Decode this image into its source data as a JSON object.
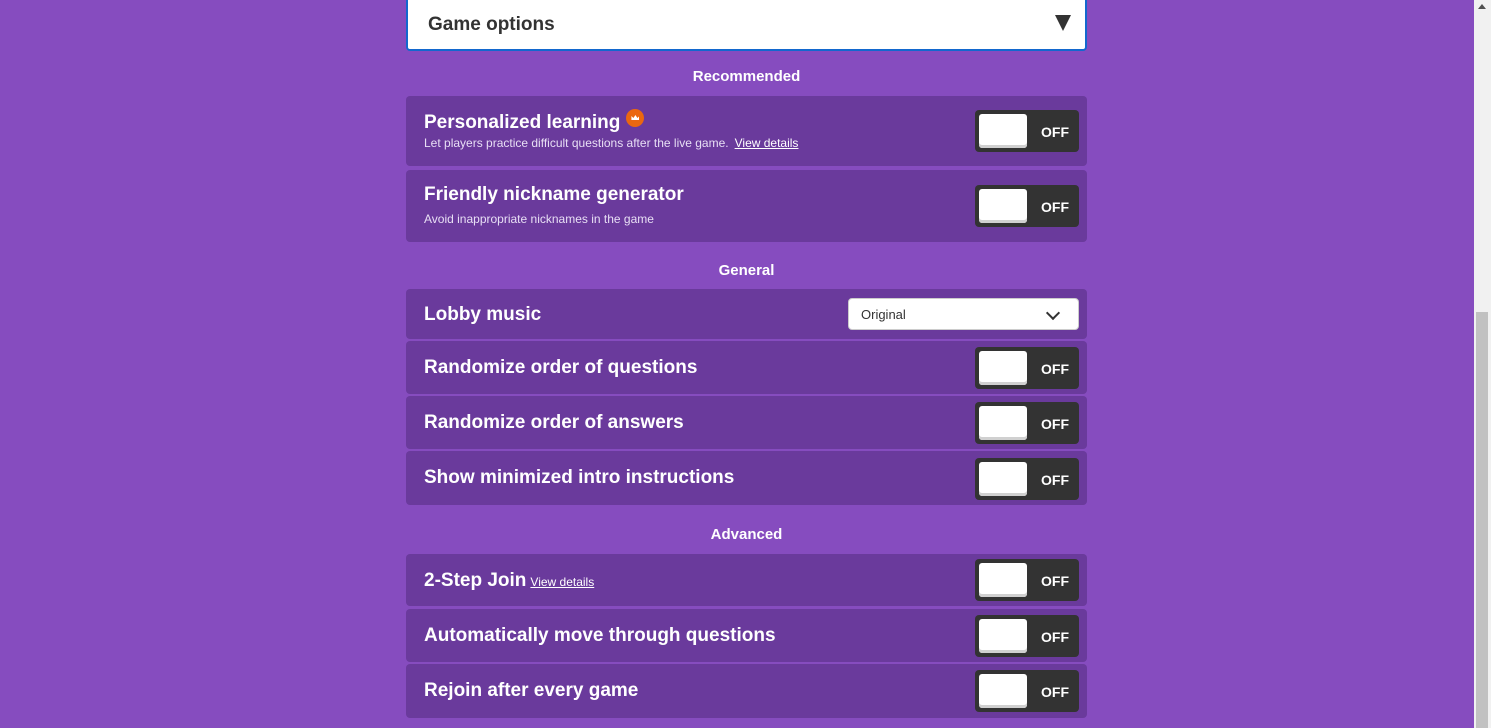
{
  "header": {
    "title": "Game options"
  },
  "sections": {
    "recommended": "Recommended",
    "general": "General",
    "advanced": "Advanced"
  },
  "personalized_learning": {
    "title": "Personalized learning",
    "description": "Let players practice difficult questions after the live game.",
    "link": "View details",
    "badge_icon": "crown-icon",
    "toggle": "OFF"
  },
  "nickname_generator": {
    "title": "Friendly nickname generator",
    "description": "Avoid inappropriate nicknames in the game",
    "toggle": "OFF"
  },
  "lobby_music": {
    "title": "Lobby music",
    "selected": "Original"
  },
  "randomize_questions": {
    "title": "Randomize order of questions",
    "toggle": "OFF"
  },
  "randomize_answers": {
    "title": "Randomize order of answers",
    "toggle": "OFF"
  },
  "minimized_intro": {
    "title": "Show minimized intro instructions",
    "toggle": "OFF"
  },
  "two_step_join": {
    "title": "2-Step Join",
    "link": "View details",
    "toggle": "OFF"
  },
  "auto_move": {
    "title": "Automatically move through questions",
    "toggle": "OFF"
  },
  "rejoin": {
    "title": "Rejoin after every game",
    "toggle": "OFF"
  },
  "colors": {
    "background": "#864cbf",
    "row": "#6a3a9c",
    "toggle_track": "#333333",
    "focus_border": "#1368ce",
    "crown": "#eb670f"
  }
}
